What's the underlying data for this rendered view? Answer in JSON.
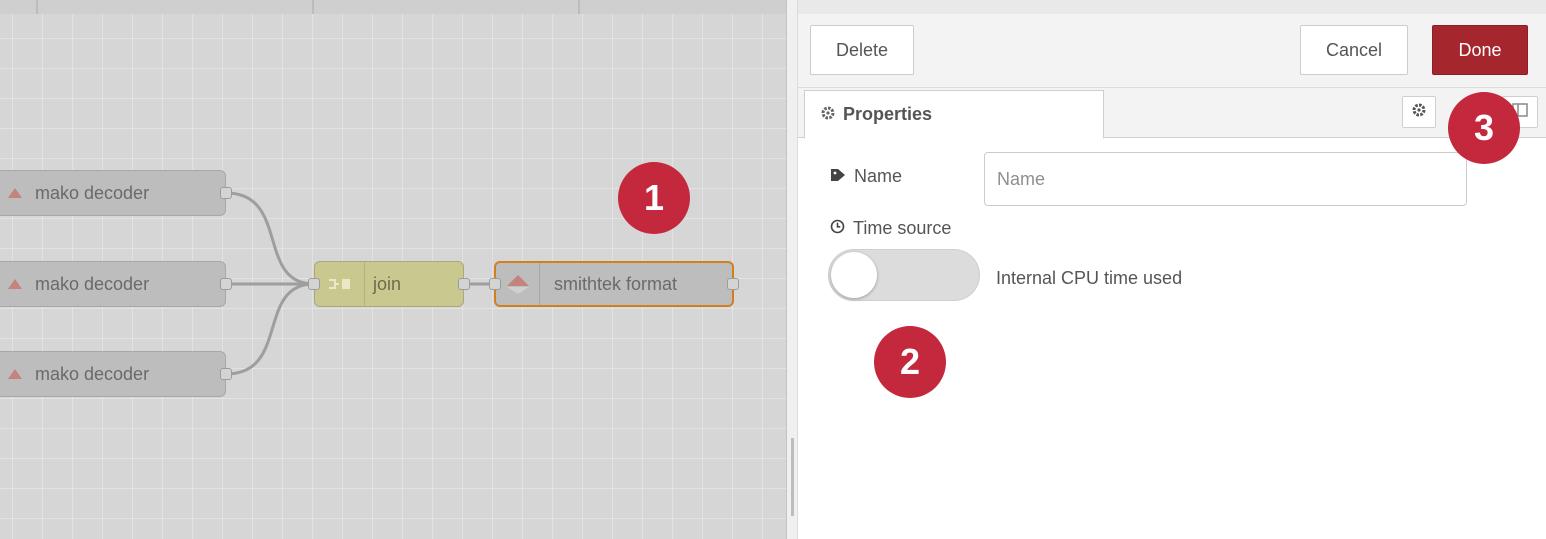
{
  "workspace": {
    "nodes": [
      {
        "label": "mako decoder"
      },
      {
        "label": "mako decoder"
      },
      {
        "label": "mako decoder"
      },
      {
        "label": "join"
      },
      {
        "label": "smithtek format"
      }
    ]
  },
  "editor": {
    "toolbar": {
      "delete_label": "Delete",
      "cancel_label": "Cancel",
      "done_label": "Done"
    },
    "tabs": [
      {
        "label": "Properties",
        "icon": "gear-icon"
      }
    ],
    "tab_icons": [
      "gear-icon",
      "layout-icon"
    ],
    "form": {
      "name_label": "Name",
      "name_placeholder": "Name",
      "name_value": "",
      "time_source_label": "Time source",
      "time_source_status": "Internal CPU time used",
      "time_source_on": false
    }
  },
  "annotations": [
    "1",
    "2",
    "3"
  ],
  "colors": {
    "accent": "#a6262e",
    "badge": "#c4283d",
    "selection": "#d2801f",
    "join_node": "#c9c98f",
    "grey_node": "#bdbdbd"
  }
}
